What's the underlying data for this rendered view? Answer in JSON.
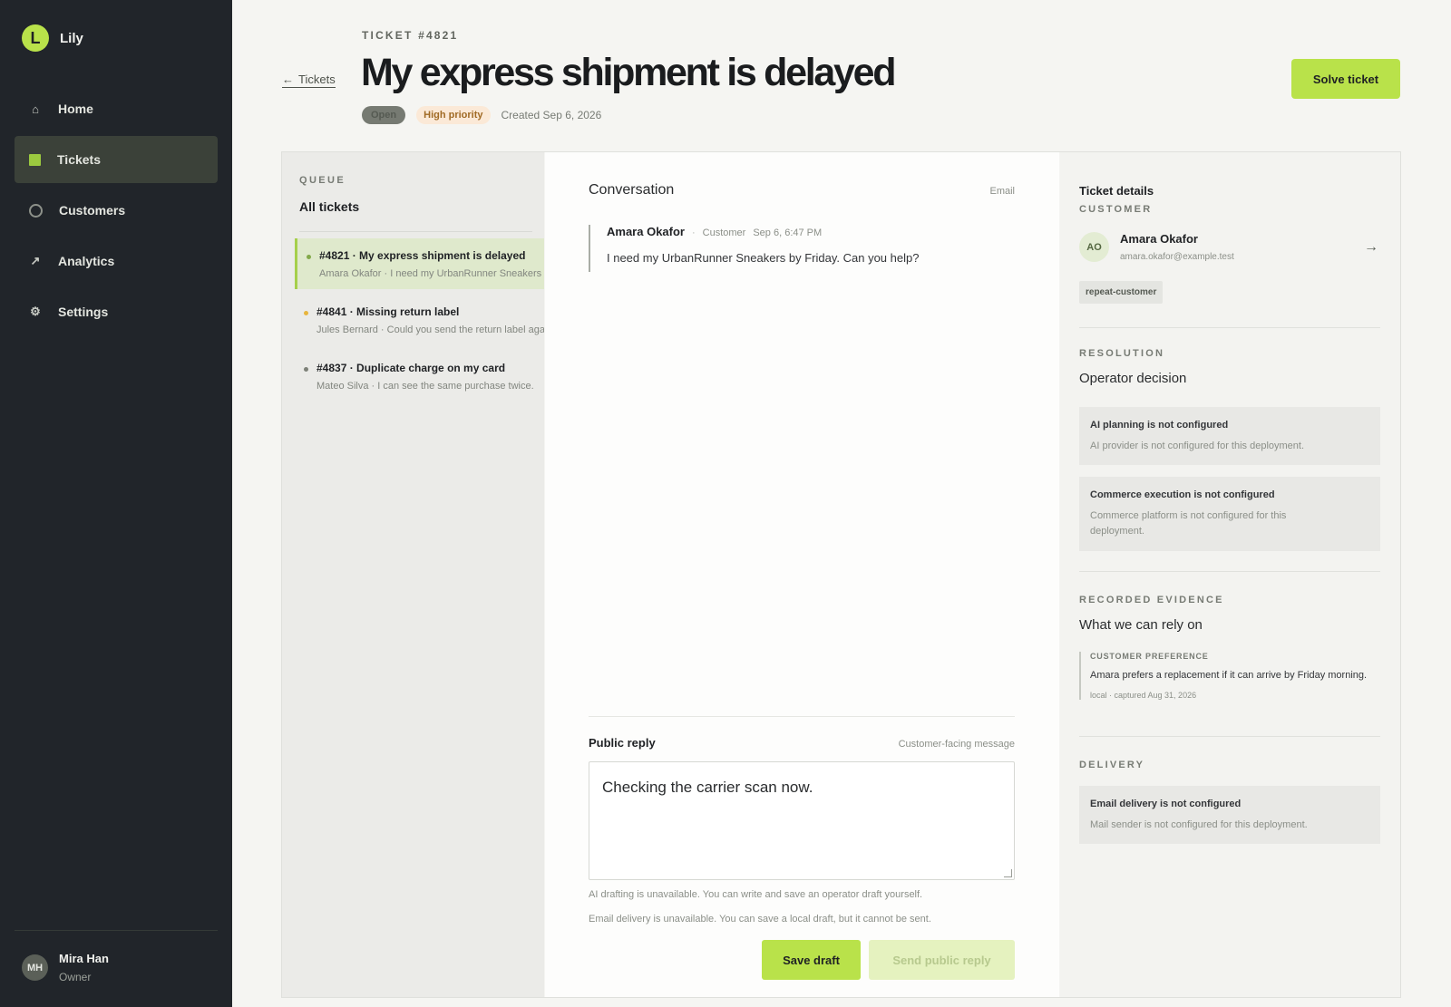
{
  "app": {
    "logo_letter": "L",
    "name": "Lily"
  },
  "nav": [
    {
      "label": "Home",
      "icon": "home-icon",
      "glyph": "⌂"
    },
    {
      "label": "Tickets",
      "icon": "tickets-icon",
      "glyph": ""
    },
    {
      "label": "Customers",
      "icon": "customers-icon",
      "glyph": ""
    },
    {
      "label": "Analytics",
      "icon": "analytics-icon",
      "glyph": "↗"
    },
    {
      "label": "Settings",
      "icon": "settings-icon",
      "glyph": "⚙"
    }
  ],
  "user": {
    "initials": "MH",
    "name": "Mira Han",
    "role": "Owner"
  },
  "header": {
    "back_arrow": "←",
    "back_label": "Tickets",
    "ticket_id": "TICKET #4821",
    "title": "My express shipment is delayed",
    "status": "Open",
    "priority": "High priority",
    "created": "Created Sep 6, 2026",
    "solve_label": "Solve ticket"
  },
  "queue": {
    "label": "QUEUE",
    "title": "All tickets",
    "items": [
      {
        "title": "#4821 · My express shipment is delayed",
        "subtitle": "Amara Okafor · I need my UrbanRunner Sneakers by Friday. Can you help?"
      },
      {
        "title": "#4841 · Missing return label",
        "subtitle": "Jules Bernard · Could you send the return label again?"
      },
      {
        "title": "#4837 · Duplicate charge on my card",
        "subtitle": "Mateo Silva · I can see the same purchase twice."
      }
    ]
  },
  "conversation": {
    "title": "Conversation",
    "channel": "Email",
    "message": {
      "author": "Amara Okafor",
      "separator": "·",
      "role": "Customer",
      "time": "Sep 6, 6:47 PM",
      "text": "I need my UrbanRunner Sneakers by Friday. Can you help?"
    },
    "reply": {
      "label": "Public reply",
      "hint": "Customer-facing message",
      "value": "Checking the carrier scan now.",
      "note_ai": "AI drafting is unavailable. You can write and save an operator draft yourself.",
      "note_email": "Email delivery is unavailable. You can save a local draft, but it cannot be sent.",
      "save_label": "Save draft",
      "send_label": "Send public reply"
    }
  },
  "details": {
    "title": "Ticket details",
    "customer_section": "CUSTOMER",
    "customer": {
      "initials": "AO",
      "name": "Amara Okafor",
      "email": "amara.okafor@example.test",
      "arrow": "→"
    },
    "tag": "repeat-customer",
    "resolution_section": "RESOLUTION",
    "resolution_heading": "Operator decision",
    "resolution_alerts": [
      {
        "title": "AI planning is not configured",
        "text": "AI provider is not configured for this deployment."
      },
      {
        "title": "Commerce execution is not configured",
        "text": "Commerce platform is not configured for this deployment."
      }
    ],
    "evidence_section": "RECORDED EVIDENCE",
    "evidence_heading": "What we can rely on",
    "evidence": {
      "label": "CUSTOMER PREFERENCE",
      "text": "Amara prefers a replacement if it can arrive by Friday morning.",
      "meta": "local · captured Aug 31, 2026"
    },
    "delivery_section": "DELIVERY",
    "delivery_alert": {
      "title": "Email delivery is not configured",
      "text": "Mail sender is not configured for this deployment."
    }
  },
  "colors": {
    "accent": "#b9e24a",
    "sidebar": "#21252a",
    "priority_bg": "#fbe9d7"
  }
}
